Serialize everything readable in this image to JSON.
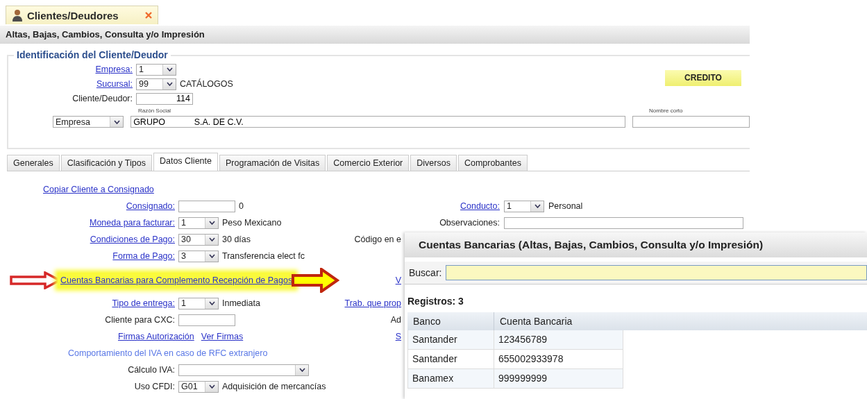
{
  "window_tab": {
    "title": "Clientes/Deudores"
  },
  "header": {
    "title": "Altas, Bajas, Cambios, Consulta y/o Impresión"
  },
  "identification": {
    "legend": "Identificación del Cliente/Deudor",
    "badge": "CREDITO",
    "fields": [
      {
        "label": "Empresa:",
        "link": true,
        "input": {
          "kind": "select",
          "value": "1"
        }
      },
      {
        "label": "Sucursal:",
        "link": true,
        "input": {
          "kind": "select",
          "value": "99"
        },
        "note": "CATÁLOGOS"
      },
      {
        "label": "Cliente/Deudor:",
        "link": false,
        "input": {
          "kind": "number",
          "value": "114"
        }
      }
    ],
    "type_select": {
      "value": "Empresa"
    },
    "business_name": {
      "caption": "Razón Social",
      "value": "GRUPO            S.A. DE C.V."
    },
    "short_name": {
      "caption": "Nombre corto"
    }
  },
  "tabs": [
    {
      "label": "Generales",
      "selected": false
    },
    {
      "label": "Clasificación y Tipos",
      "selected": false
    },
    {
      "label": "Datos Cliente",
      "selected": true
    },
    {
      "label": "Programación de Visitas",
      "selected": false
    },
    {
      "label": "Comercio Exterior",
      "selected": false
    },
    {
      "label": "Diversos",
      "selected": false
    },
    {
      "label": "Comprobantes",
      "selected": false
    }
  ],
  "client_data": {
    "rows": [
      {
        "kind": "link",
        "text": "Copiar Cliente a Consignado"
      },
      {
        "kind": "field",
        "label": "Consignado:",
        "link": true,
        "input": {
          "kind": "text"
        },
        "note": "0",
        "right": {
          "kind": "field",
          "label": "Conducto:",
          "link": true,
          "input": {
            "kind": "select",
            "value": "1"
          },
          "note": "Personal"
        }
      },
      {
        "kind": "field",
        "label": "Moneda para facturar:",
        "link": true,
        "input": {
          "kind": "select",
          "value": "1"
        },
        "note": "Peso Mexicano",
        "right": {
          "kind": "field",
          "label": "Observaciones:",
          "link": false,
          "input": {
            "kind": "wide"
          }
        }
      },
      {
        "kind": "field",
        "label": "Condiciones de Pago:",
        "link": true,
        "input": {
          "kind": "select",
          "value": "30"
        },
        "note": "30 días",
        "right": {
          "kind": "text",
          "text": "Código en e"
        }
      },
      {
        "kind": "field",
        "label": "Forma de Pago:",
        "link": true,
        "input": {
          "kind": "select",
          "value": "3"
        },
        "note": "Transferencia elect fc"
      },
      {
        "kind": "highlight",
        "text": "Cuentas Bancarias para Complemento Recepción de Pagos",
        "highlighted": true,
        "right": {
          "kind": "link",
          "text": "V"
        }
      },
      {
        "kind": "field",
        "label": "Tipo de entrega:",
        "link": true,
        "input": {
          "kind": "select",
          "value": "1"
        },
        "note": "Inmediata",
        "right": {
          "kind": "link",
          "text": "Trab. que prop"
        }
      },
      {
        "kind": "field",
        "label": "Cliente para CXC:",
        "link": false,
        "input": {
          "kind": "text"
        },
        "right": {
          "kind": "text",
          "text": "Ad"
        }
      },
      {
        "kind": "links",
        "links": [
          "Firmas Autorización",
          "Ver Firmas"
        ],
        "right": {
          "kind": "link",
          "text": "S"
        }
      },
      {
        "kind": "note",
        "text": "Comportamiento del IVA en caso de RFC extranjero"
      },
      {
        "kind": "field",
        "label": "Cálculo IVA:",
        "link": false,
        "input": {
          "kind": "wideselect"
        }
      },
      {
        "kind": "field",
        "label": "Uso CFDI:",
        "link": false,
        "input": {
          "kind": "select",
          "value": "G01"
        },
        "note": "Adquisición de mercancías"
      }
    ]
  },
  "bank_dialog": {
    "title": "Cuentas Bancarias (Altas, Bajas, Cambios, Consulta y/o Impresión)",
    "search_label": "Buscar:",
    "count": "Registros: 3",
    "columns": [
      "Banco",
      "Cuenta Bancaria"
    ],
    "rows": [
      [
        "Santander",
        "123456789"
      ],
      [
        "Santander",
        "655002933978"
      ],
      [
        "Banamex",
        "999999999"
      ]
    ]
  }
}
